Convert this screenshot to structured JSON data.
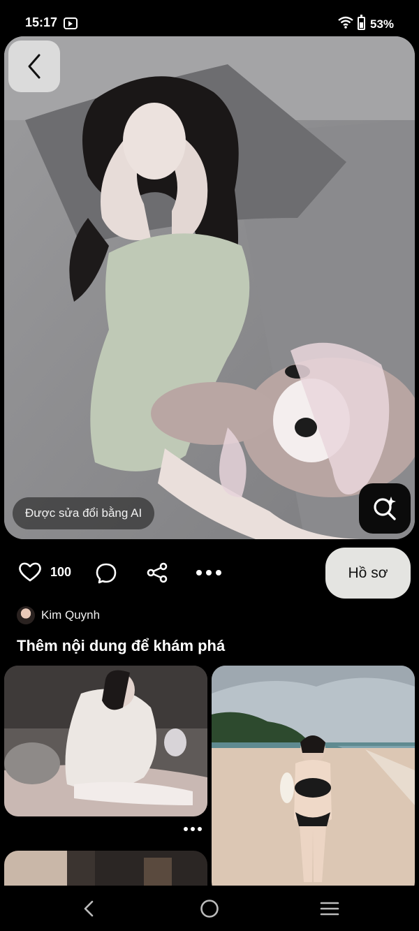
{
  "status": {
    "time": "15:17",
    "battery": "53%"
  },
  "pin": {
    "ai_badge": "Được sửa đổi bằng AI",
    "likes": "100",
    "profile_button": "Hồ sơ",
    "author": "Kim Quynh"
  },
  "section": {
    "title": "Thêm nội dung để khám phá"
  },
  "icons": {
    "back": "chevron-left-icon",
    "lens": "visual-search-sparkle-icon",
    "like": "heart-icon",
    "comment": "comment-bubble-icon",
    "share": "share-icon",
    "more": "more-dots-icon",
    "nav_back": "nav-back-icon",
    "nav_home": "nav-home-icon",
    "nav_recents": "nav-recents-icon"
  }
}
